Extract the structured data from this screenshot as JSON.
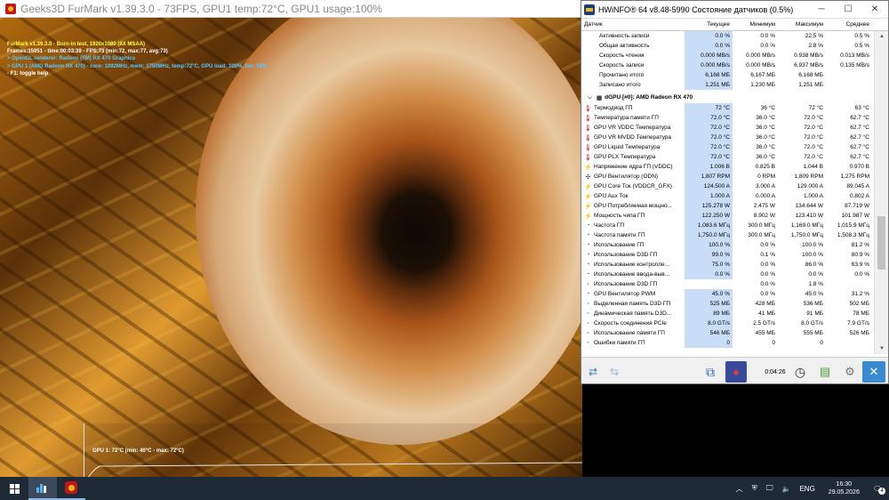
{
  "furmark": {
    "title": "Geeks3D FurMark v1.39.3.0 - 73FPS, GPU1 temp:72°C, GPU1 usage:100%",
    "hud": {
      "line1": "FurMark v1.39.3.0 - Burn-in test, 1920x1080 (8X MSAA)",
      "line2": "Frames:15951 - time:00:03:39 - FPS:73 (min:72, max:77, avg:73)",
      "line3": "> OpenGL renderer: Radeon (TM) RX 470 Graphics",
      "line4": "> GPU 1 (AMD Radeon RX 470) - core: 1092MHz, mem: 1750MHz, temp:72°C, GPU load: 100%, fan: 58%",
      "line5": "- F1: toggle help"
    },
    "graph_label": "GPU 1: 72°C (min: 40°C - max: 72°C)"
  },
  "hwinfo": {
    "title": "HWiNFO® 64 v8.48-5990 Состояние датчиков (0.5%)",
    "columns": [
      "Датчик",
      "Текущее",
      "Минимум",
      "Максимум",
      "Среднее"
    ],
    "rows_top": [
      {
        "name": "Активность записи",
        "cur": "0.0 %",
        "min": "0.0 %",
        "max": "22.5 %",
        "avg": "0.5 %"
      },
      {
        "name": "Общая активность",
        "cur": "0.0 %",
        "min": "0.0 %",
        "max": "2.8 %",
        "avg": "0.5 %"
      },
      {
        "name": "Скорость чтения",
        "cur": "0.000 MB/s",
        "min": "0.000 MB/s",
        "max": "0.938 MB/s",
        "avg": "0.013 MB/s"
      },
      {
        "name": "Скорость записи",
        "cur": "0.000 MB/s",
        "min": "0.000 MB/s",
        "max": "6.937 MB/s",
        "avg": "0.135 MB/s"
      },
      {
        "name": "Прочитано итого",
        "cur": "6,168 МБ",
        "min": "6,167 МБ",
        "max": "6,168 МБ",
        "avg": ""
      },
      {
        "name": "Записано итого",
        "cur": "1,251 МБ",
        "min": "1,230 МБ",
        "max": "1,251 МБ",
        "avg": ""
      }
    ],
    "group_label": "dGPU [#0]: AMD Radeon RX 470",
    "rows_gpu": [
      {
        "icon": "thermometer",
        "name": "Термодиод ГП",
        "cur": "72 °C",
        "min": "36 °C",
        "max": "72 °C",
        "avg": "63 °C"
      },
      {
        "icon": "thermometer",
        "name": "Температура памяти ГП",
        "cur": "72.0 °C",
        "min": "36.0 °C",
        "max": "72.0 °C",
        "avg": "62.7 °C"
      },
      {
        "icon": "thermometer",
        "name": "GPU VR VDDC Температура",
        "cur": "72.0 °C",
        "min": "36.0 °C",
        "max": "72.0 °C",
        "avg": "62.7 °C"
      },
      {
        "icon": "thermometer",
        "name": "GPU VR MVDD Температура",
        "cur": "72.0 °C",
        "min": "36.0 °C",
        "max": "72.0 °C",
        "avg": "62.7 °C"
      },
      {
        "icon": "thermometer",
        "name": "GPU Liquid Температура",
        "cur": "72.0 °C",
        "min": "36.0 °C",
        "max": "72.0 °C",
        "avg": "62.7 °C"
      },
      {
        "icon": "thermometer",
        "name": "GPU PLX Температура",
        "cur": "72.0 °C",
        "min": "36.0 °C",
        "max": "72.0 °C",
        "avg": "62.7 °C"
      },
      {
        "icon": "voltage",
        "name": "Напряжение ядра ГП (VDDC)",
        "cur": "1.006 В",
        "min": "0.825 В",
        "max": "1.044 В",
        "avg": "0.970 В"
      },
      {
        "icon": "fan",
        "name": "GPU Вентилятор (ODN)",
        "cur": "1,807 RPM",
        "min": "0 RPM",
        "max": "1,809 RPM",
        "avg": "1,275 RPM"
      },
      {
        "icon": "voltage",
        "name": "GPU Core Ток (VDDCR_GFX)",
        "cur": "124.500 A",
        "min": "3.000 A",
        "max": "129.000 A",
        "avg": "89.045 A"
      },
      {
        "icon": "voltage",
        "name": "GPU Aux Ток",
        "cur": "1.000 A",
        "min": "0.000 A",
        "max": "1.000 A",
        "avg": "0.802 A"
      },
      {
        "icon": "voltage",
        "name": "GPU Потребляемая мощно...",
        "cur": "125.278 W",
        "min": "2.475 W",
        "max": "134.644 W",
        "avg": "87.719 W"
      },
      {
        "icon": "voltage",
        "name": "Мощность чипа ГП",
        "cur": "122.250 W",
        "min": "8.902 W",
        "max": "123.410 W",
        "avg": "101.987 W"
      },
      {
        "icon": "clock",
        "name": "Частота ГП",
        "cur": "1,083.6 МГц",
        "min": "300.0 МГц",
        "max": "1,169.0 МГц",
        "avg": "1,015.9 МГц"
      },
      {
        "icon": "clock",
        "name": "Частота памяти ГП",
        "cur": "1,750.0 МГц",
        "min": "300.0 МГц",
        "max": "1,750.0 МГц",
        "avg": "1,508.3 МГц"
      },
      {
        "icon": "clock",
        "name": "Использование ГП",
        "cur": "100.0 %",
        "min": "0.0 %",
        "max": "100.0 %",
        "avg": "81.2 %"
      },
      {
        "icon": "clock",
        "name": "Использование D3D ГП",
        "cur": "99.0 %",
        "min": "0.1 %",
        "max": "100.0 %",
        "avg": "80.9 %"
      },
      {
        "icon": "clock",
        "name": "Использование контролле...",
        "cur": "75.0 %",
        "min": "0.0 %",
        "max": "86.0 %",
        "avg": "63.9 %"
      },
      {
        "icon": "clock",
        "name": "Использование ввода-выв...",
        "cur": "0.0 %",
        "min": "0.0 %",
        "max": "0.0 %",
        "avg": "0.0 %"
      },
      {
        "icon": "expand",
        "name": "Использование D3D ГП",
        "cur": "",
        "min": "0.0 %",
        "max": "1.8 %",
        "avg": ""
      },
      {
        "icon": "clock",
        "name": "GPU Вентилятор PWM",
        "cur": "45.0 %",
        "min": "0.0 %",
        "max": "45.0 %",
        "avg": "31.2 %"
      },
      {
        "icon": "chip",
        "name": "Выделенная память D3D ГП",
        "cur": "525 МБ",
        "min": "428 МБ",
        "max": "536 МБ",
        "avg": "502 МБ"
      },
      {
        "icon": "chip",
        "name": "Динамическая память D3D...",
        "cur": "89 МБ",
        "min": "41 МБ",
        "max": "91 МБ",
        "avg": "78 МБ"
      },
      {
        "icon": "chip",
        "name": "Скорость соединения PCIe",
        "cur": "8.0 GT/s",
        "min": "2.5 GT/s",
        "max": "8.0 GT/s",
        "avg": "7.9 GT/s"
      },
      {
        "icon": "chip",
        "name": "Использование памяти ГП",
        "cur": "546 МБ",
        "min": "455 МБ",
        "max": "555 МБ",
        "avg": "526 МБ"
      },
      {
        "icon": "chip",
        "name": "Ошибки памяти ГП",
        "cur": "0",
        "min": "0",
        "max": "0",
        "avg": ""
      }
    ],
    "timer": "0:04:26"
  },
  "taskbar": {
    "lang": "ENG",
    "time": "16:30",
    "date": "29.05.2026",
    "notifications": "4"
  },
  "colors": {
    "accent_blue_cell": "#c9ddf7",
    "taskbar_bg": "#1e2a36",
    "thermo_red": "#c00000"
  }
}
